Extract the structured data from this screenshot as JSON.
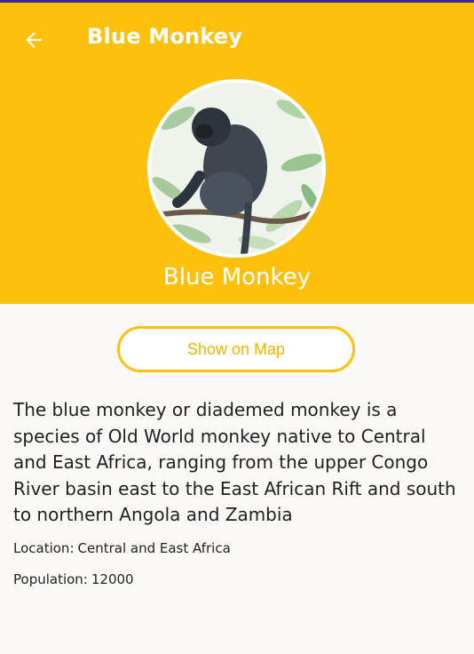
{
  "header": {
    "title": "Blue Monkey",
    "back_icon": "arrow-left-icon",
    "background_color": "#fdc10d"
  },
  "animal": {
    "name": "Blue Monkey",
    "photo": "blue-monkey-photo",
    "description": "The blue monkey or diademed monkey is a species of Old World monkey native to Central and East Africa, ranging from the upper Congo River basin east to the East African Rift and south to northern Angola and Zambia",
    "location_label": "Location:",
    "location_value": "Central and East Africa",
    "population_label": "Population:",
    "population_value": "12000"
  },
  "actions": {
    "map_button_label": "Show on Map",
    "accent_color": "#fdc10d"
  }
}
